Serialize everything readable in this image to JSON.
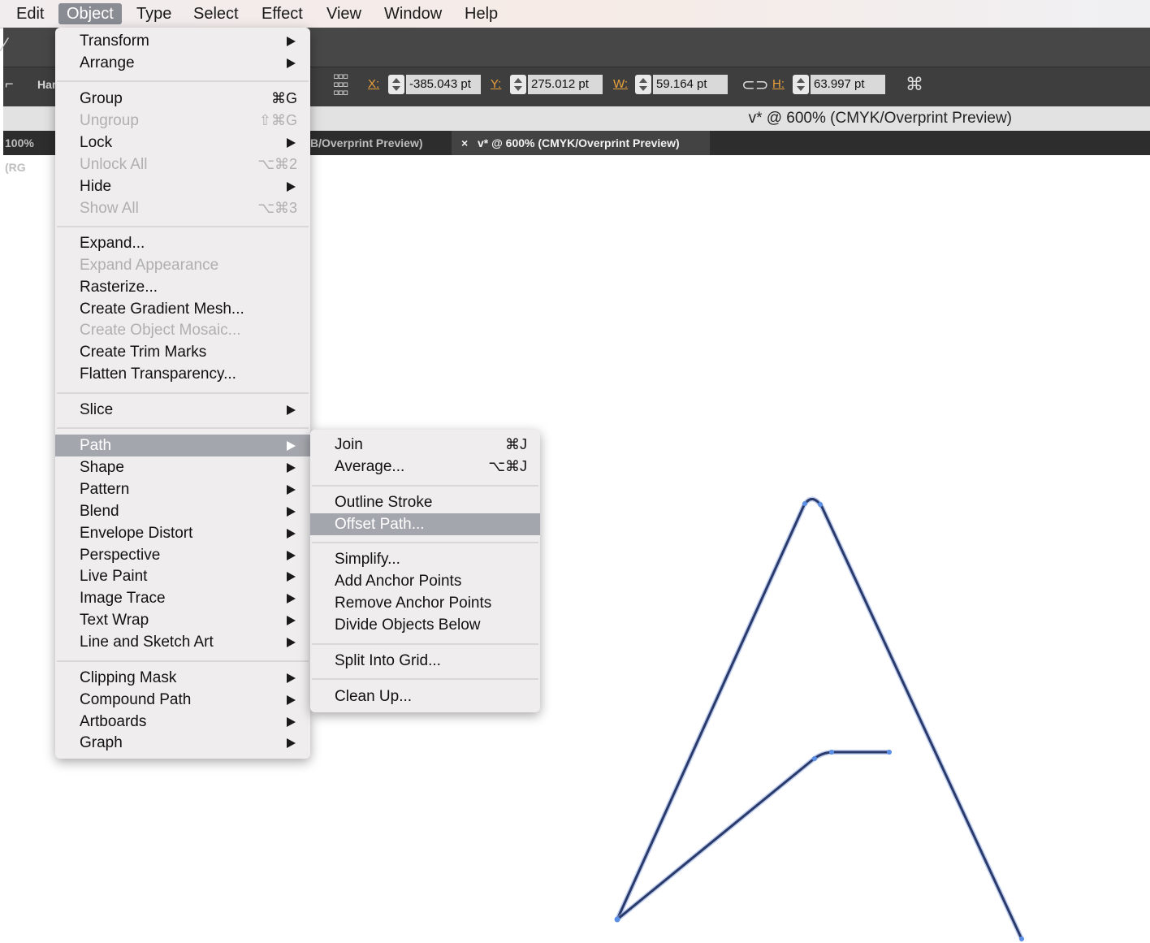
{
  "menubar": {
    "items": [
      "Edit",
      "Object",
      "Type",
      "Select",
      "Effect",
      "View",
      "Window",
      "Help"
    ]
  },
  "control_bar": {
    "hand_label": "Har",
    "x_label": "X:",
    "x_value": "-385.043 pt",
    "y_label": "Y:",
    "y_value": "275.012 pt",
    "w_label": "W:",
    "w_value": "59.164 pt",
    "h_label": "H:",
    "h_value": "63.997 pt"
  },
  "document": {
    "title": "v* @ 600% (CMYK/Overprint Preview)",
    "tab1": "100% (RG",
    "tab2": "B/Overprint Preview)",
    "tab3": "v* @ 600% (CMYK/Overprint Preview)",
    "tab3_close": "×"
  },
  "object_menu": {
    "items": {
      "transform": "Transform",
      "arrange": "Arrange",
      "group": "Group",
      "group_sc": "⌘G",
      "ungroup": "Ungroup",
      "ungroup_sc": "⇧⌘G",
      "lock": "Lock",
      "unlock_all": "Unlock All",
      "unlock_all_sc": "⌥⌘2",
      "hide": "Hide",
      "show_all": "Show All",
      "show_all_sc": "⌥⌘3",
      "expand": "Expand...",
      "expand_appearance": "Expand Appearance",
      "rasterize": "Rasterize...",
      "gradient_mesh": "Create Gradient Mesh...",
      "object_mosaic": "Create Object Mosaic...",
      "trim_marks": "Create Trim Marks",
      "flatten": "Flatten Transparency...",
      "slice": "Slice",
      "path": "Path",
      "shape": "Shape",
      "pattern": "Pattern",
      "blend": "Blend",
      "envelope": "Envelope Distort",
      "perspective": "Perspective",
      "live_paint": "Live Paint",
      "image_trace": "Image Trace",
      "text_wrap": "Text Wrap",
      "line_sketch": "Line and Sketch Art",
      "clipping_mask": "Clipping Mask",
      "compound_path": "Compound Path",
      "artboards": "Artboards",
      "graph": "Graph"
    }
  },
  "path_submenu": {
    "items": {
      "join": "Join",
      "join_sc": "⌘J",
      "average": "Average...",
      "average_sc": "⌥⌘J",
      "outline_stroke": "Outline Stroke",
      "offset_path": "Offset Path...",
      "simplify": "Simplify...",
      "add_anchor": "Add Anchor Points",
      "remove_anchor": "Remove Anchor Points",
      "divide_below": "Divide Objects Below",
      "split_grid": "Split Into Grid...",
      "clean_up": "Clean Up..."
    }
  },
  "colors": {
    "path_stroke": "#2a3a6a",
    "anchor": "#5b8fe6",
    "highlight": "#a4a6ad",
    "field_label": "#e8a03a"
  }
}
